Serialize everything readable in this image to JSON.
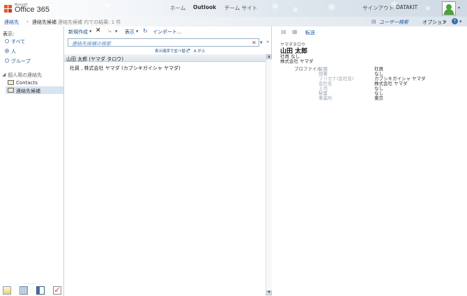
{
  "header": {
    "brand_small": "Microsoft",
    "brand": "Office 365",
    "nav": [
      "ホーム",
      "Outlook",
      "チーム サイト"
    ],
    "signout": "サインアウト",
    "user": "DATAKIT",
    "user_search": "ユーザー検索",
    "options": "オプション",
    "help": "?"
  },
  "breadcrumb": {
    "root": "連絡先",
    "current": "連絡先候補",
    "summary": "連絡先候補 内での結果: 1 件"
  },
  "left": {
    "show_label": "表示:",
    "filters": [
      "すべて",
      "人",
      "グループ"
    ],
    "selected_filter": "人",
    "section": "個人用の連絡先",
    "folders": [
      "Contacts",
      "連絡先候補"
    ],
    "selected_folder": "連絡先候補"
  },
  "toolbar": {
    "new": "新規作成",
    "view": "表示",
    "import": "インポート..."
  },
  "search": {
    "placeholder": "連絡先候補の検索"
  },
  "sort": {
    "label": "表示順序で並べ替え",
    "direction": "A が上"
  },
  "list": {
    "group": "山田 太郎 (ヤマダ タロウ)",
    "item": "社員 , 株式会社 ヤマダ (カブシキガイシャ ヤマダ)"
  },
  "reading": {
    "forward": "転送",
    "furigana": "ヤマダタロウ",
    "name": "山田 太郎",
    "title_line1": "社員 なし",
    "title_line2": "株式会社 ヤマダ",
    "profile_label": "プロファイル",
    "fields": [
      {
        "label": "役職",
        "value": "社員"
      },
      {
        "label": "部署",
        "value": "なし"
      },
      {
        "label": "フリガナ(会社名)",
        "value": "カブシキガイシャ ヤマダ"
      },
      {
        "label": "会社名",
        "value": "株式会社 ヤマダ"
      },
      {
        "label": "上司",
        "value": "なし"
      },
      {
        "label": "秘書",
        "value": "なし"
      },
      {
        "label": "事業所",
        "value": "東京"
      }
    ]
  },
  "colors": {
    "accent": "#1c5aa4",
    "logo_orange": "#e45c1f",
    "logo_red": "#d2322d",
    "selection": "#d7e4f2"
  }
}
